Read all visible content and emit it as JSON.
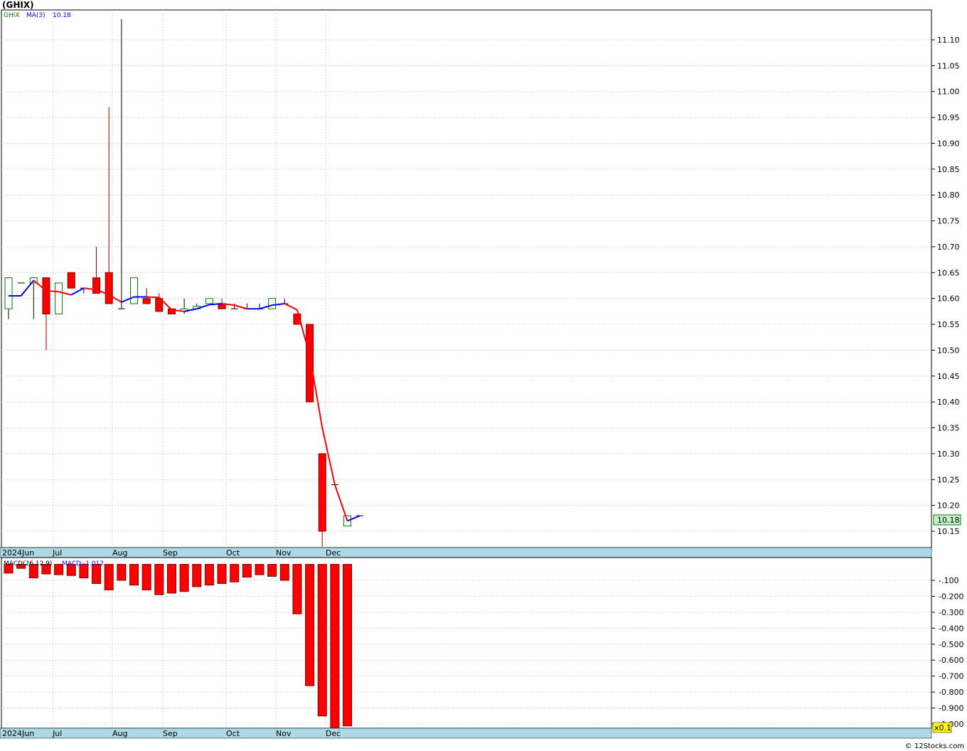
{
  "title": "(GHIX)",
  "credit": "© 12Stocks.com",
  "legend": {
    "symbol": "GHIX",
    "ma_label": "MA(3)",
    "ma_value": "10.18",
    "macd_label": "MACD(26,12,9)",
    "macd_value": "MACD:-1.012"
  },
  "last_price_label": "10.18",
  "scale_label": "x0.1",
  "colors": {
    "up": "#008000",
    "down": "#ff0000",
    "ma_up": "#0000ff",
    "ma_down": "#ff0000",
    "axis_band": "#add8e6",
    "last_price_bg": "#c8f0c8",
    "scale_bg": "#ffff00"
  },
  "chart_data": [
    {
      "type": "candlestick",
      "ylim": [
        10.12,
        11.14
      ],
      "ticks": [
        "10.15",
        "10.20",
        "10.25",
        "10.30",
        "10.35",
        "10.40",
        "10.45",
        "10.50",
        "10.55",
        "10.60",
        "10.65",
        "10.70",
        "10.75",
        "10.80",
        "10.85",
        "10.90",
        "10.95",
        "11.00",
        "11.05",
        "11.10"
      ],
      "month_labels": [
        "2024Jun",
        "Jul",
        "Aug",
        "Sep",
        "Oct",
        "Nov",
        "Dec"
      ],
      "candles": [
        {
          "o": 10.58,
          "h": 10.64,
          "l": 10.56,
          "c": 10.64,
          "ma": 10.605
        },
        {
          "o": 10.63,
          "h": 10.63,
          "l": 10.63,
          "c": 10.63,
          "ma": 10.605
        },
        {
          "o": 10.63,
          "h": 10.64,
          "l": 10.56,
          "c": 10.64,
          "ma": 10.635
        },
        {
          "o": 10.64,
          "h": 10.64,
          "l": 10.5,
          "c": 10.57,
          "ma": 10.615
        },
        {
          "o": 10.57,
          "h": 10.63,
          "l": 10.57,
          "c": 10.63,
          "ma": 10.613
        },
        {
          "o": 10.65,
          "h": 10.65,
          "l": 10.62,
          "c": 10.62,
          "ma": 10.607
        },
        {
          "o": 10.62,
          "h": 10.62,
          "l": 10.61,
          "c": 10.62,
          "ma": 10.62
        },
        {
          "o": 10.64,
          "h": 10.7,
          "l": 10.61,
          "c": 10.61,
          "ma": 10.617
        },
        {
          "o": 10.65,
          "h": 10.97,
          "l": 10.59,
          "c": 10.59,
          "ma": 10.607
        },
        {
          "o": 10.58,
          "h": 11.14,
          "l": 10.58,
          "c": 10.58,
          "ma": 10.593
        },
        {
          "o": 10.59,
          "h": 10.64,
          "l": 10.59,
          "c": 10.64,
          "ma": 10.603
        },
        {
          "o": 10.6,
          "h": 10.62,
          "l": 10.59,
          "c": 10.59,
          "ma": 10.603
        },
        {
          "o": 10.6,
          "h": 10.61,
          "l": 10.575,
          "c": 10.575,
          "ma": 10.602
        },
        {
          "o": 10.58,
          "h": 10.58,
          "l": 10.57,
          "c": 10.57,
          "ma": 10.578
        },
        {
          "o": 10.575,
          "h": 10.6,
          "l": 10.57,
          "c": 10.58,
          "ma": 10.575
        },
        {
          "o": 10.58,
          "h": 10.59,
          "l": 10.58,
          "c": 10.585,
          "ma": 10.58
        },
        {
          "o": 10.59,
          "h": 10.6,
          "l": 10.59,
          "c": 10.6,
          "ma": 10.588
        },
        {
          "o": 10.59,
          "h": 10.6,
          "l": 10.58,
          "c": 10.58,
          "ma": 10.59
        },
        {
          "o": 10.58,
          "h": 10.59,
          "l": 10.58,
          "c": 10.58,
          "ma": 10.587
        },
        {
          "o": 10.58,
          "h": 10.59,
          "l": 10.58,
          "c": 10.58,
          "ma": 10.58
        },
        {
          "o": 10.58,
          "h": 10.59,
          "l": 10.58,
          "c": 10.58,
          "ma": 10.58
        },
        {
          "o": 10.58,
          "h": 10.6,
          "l": 10.58,
          "c": 10.6,
          "ma": 10.587
        },
        {
          "o": 10.59,
          "h": 10.6,
          "l": 10.59,
          "c": 10.59,
          "ma": 10.59
        },
        {
          "o": 10.57,
          "h": 10.57,
          "l": 10.55,
          "c": 10.55,
          "ma": 10.578
        },
        {
          "o": 10.55,
          "h": 10.55,
          "l": 10.4,
          "c": 10.4,
          "ma": 10.49
        },
        {
          "o": 10.3,
          "h": 10.3,
          "l": 10.12,
          "c": 10.15,
          "ma": 10.35
        },
        {
          "o": 10.24,
          "h": 10.24,
          "l": 10.24,
          "c": 10.24,
          "ma": 10.24
        },
        {
          "o": 10.16,
          "h": 10.18,
          "l": 10.16,
          "c": 10.18,
          "ma": 10.17
        },
        {
          "o": 10.18,
          "h": 10.18,
          "l": 10.18,
          "c": 10.18,
          "ma": 10.18
        }
      ]
    },
    {
      "type": "bar",
      "name": "MACD(26,12,9)",
      "ylim": [
        -1.05,
        0.0
      ],
      "ticks": [
        "-.100",
        "-0.200",
        "-0.300",
        "-0.400",
        "-0.500",
        "-0.600",
        "-0.700",
        "-0.800",
        "-0.900",
        "-1.000"
      ],
      "values": [
        -0.055,
        -0.025,
        -0.085,
        -0.06,
        -0.065,
        -0.07,
        -0.085,
        -0.12,
        -0.16,
        -0.1,
        -0.13,
        -0.16,
        -0.19,
        -0.18,
        -0.17,
        -0.14,
        -0.13,
        -0.12,
        -0.11,
        -0.08,
        -0.065,
        -0.075,
        -0.1,
        -0.31,
        -0.76,
        -0.95,
        -1.03,
        -1.012
      ]
    }
  ]
}
